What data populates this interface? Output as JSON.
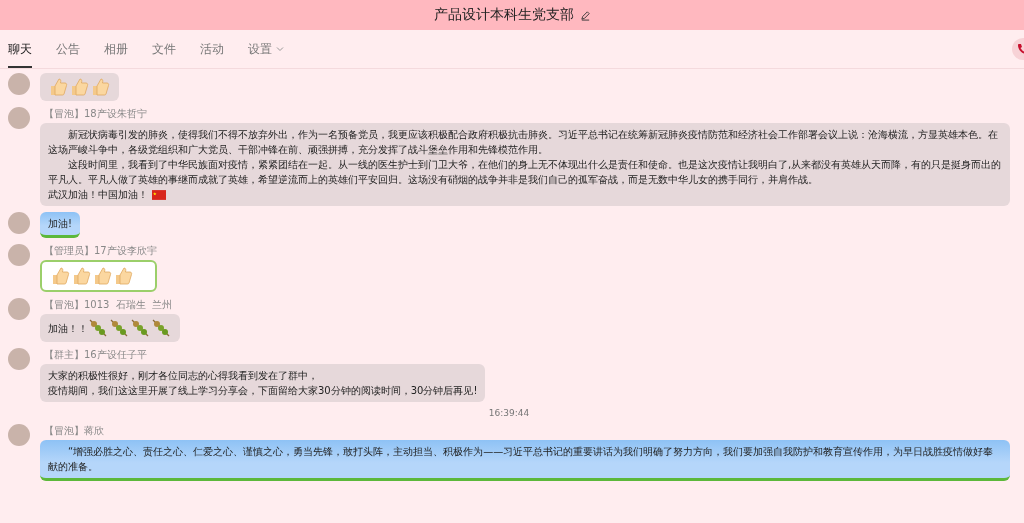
{
  "window": {
    "title": "产品设计本科生党支部"
  },
  "tabs": [
    {
      "label": "聊天",
      "selected": true
    },
    {
      "label": "公告",
      "selected": false
    },
    {
      "label": "相册",
      "selected": false
    },
    {
      "label": "文件",
      "selected": false
    },
    {
      "label": "活动",
      "selected": false
    },
    {
      "label": "设置",
      "selected": false,
      "dropdown": true
    }
  ],
  "messages": [
    {
      "kind": "plain",
      "icons": [
        {
          "kind": "thumb"
        },
        {
          "kind": "thumb"
        },
        {
          "kind": "thumb"
        }
      ]
    },
    {
      "kind": "plain",
      "sender": "【冒泡】18产设朱哲宁",
      "paragraphs": [
        {
          "text": "新冠状病毒引发的肺炎，使得我们不得不放弃外出，作为一名预备党员，我更应该积极配合政府积极抗击肺炎。习近平总书记在统筹新冠肺炎疫情防范和经济社会工作部署会议上说：沧海横流，方显英雄本色。在这场严峻斗争中，各级党组织和广大党员、干部冲锋在前、顽强拼搏，充分发挥了战斗堡垒作用和先锋模范作用。",
          "indented": true
        },
        {
          "text": "这段时间里，我看到了中华民族面对疫情，紧紧团结在一起。从一线的医生护士到门卫大爷，在他们的身上无不体现出什么是责任和使命。也是这次疫情让我明白了,从来都没有英雄从天而降，有的只是挺身而出的平凡人。平凡人做了英雄的事继而成就了英雄，希望逆流而上的英雄们平安回归。这场没有硝烟的战争并非是我们自己的孤军奋战，而是无数中华儿女的携手同行，并肩作战。",
          "indented": true
        },
        {
          "text": "武汉加油！中国加油！",
          "indented": false
        }
      ],
      "icons": [
        {
          "kind": "flag"
        }
      ]
    },
    {
      "kind": "blue",
      "paragraphs": [
        {
          "text": "加油!",
          "indented": false
        }
      ]
    },
    {
      "kind": "green",
      "sender": "【管理员】17产设李欣宇",
      "icons": [
        {
          "kind": "thumb"
        },
        {
          "kind": "thumb"
        },
        {
          "kind": "thumb"
        },
        {
          "kind": "thumb"
        }
      ]
    },
    {
      "kind": "plain",
      "sender": "【冒泡】1013  石瑞生  兰州",
      "paragraphs": [
        {
          "text": "加油！！",
          "indented": false
        }
      ],
      "icons": [
        {
          "kind": "skewer"
        },
        {
          "kind": "skewer"
        },
        {
          "kind": "skewer"
        },
        {
          "kind": "skewer"
        }
      ]
    },
    {
      "kind": "plain",
      "sender": "【群主】16产设任子平",
      "paragraphs": [
        {
          "text": "大家的积极性很好，刚才各位同志的心得我看到发在了群中，",
          "indented": false
        },
        {
          "text": "疫情期间，我们这这里开展了线上学习分享会，下面留给大家30分钟的阅读时间，30分钟后再见!",
          "indented": false
        }
      ]
    },
    {
      "kind": "time",
      "text": "16:39:44"
    },
    {
      "kind": "blue",
      "sender": "【冒泡】蒋欣",
      "paragraphs": [
        {
          "text": "“增强必胜之心、责任之心、仁爱之心、谨慎之心，勇当先锋，敢打头阵，主动担当、积极作为——习近平总书记的重要讲话为我们明确了努力方向，我们要加强自我防护和教育宣传作用，为早日战胜疫情做好奉献的准备。",
          "indented": true
        }
      ]
    }
  ]
}
